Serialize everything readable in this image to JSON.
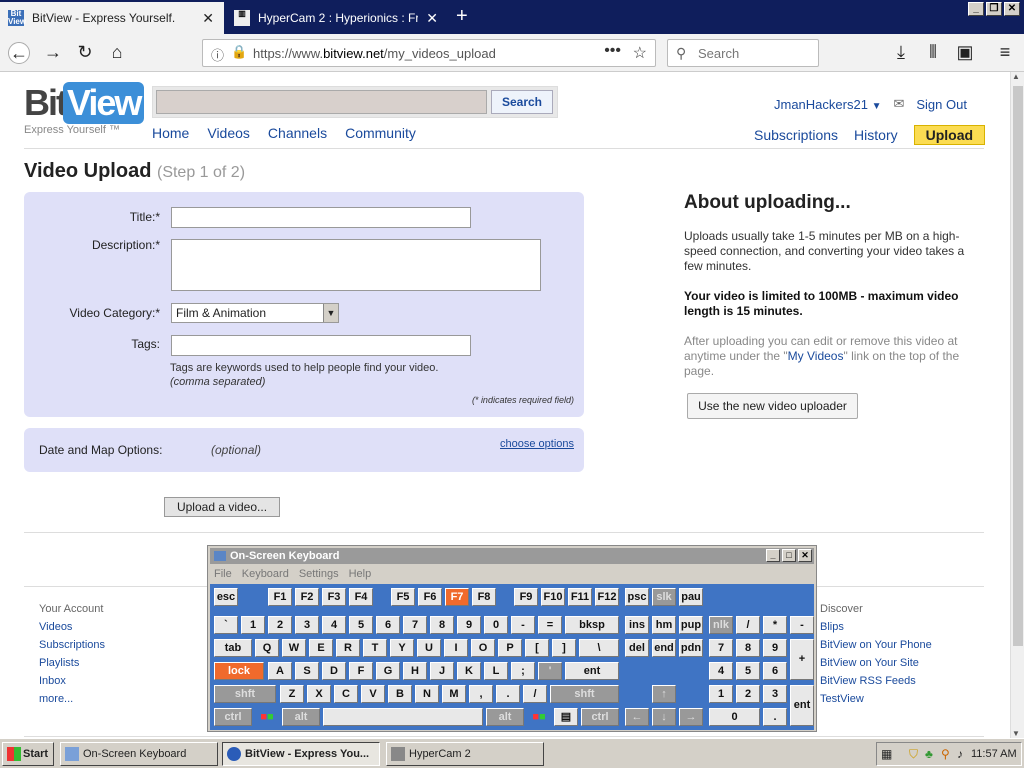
{
  "browser": {
    "tabs": [
      {
        "title": "BitView - Express Yourself.",
        "favicon": "bitview-icon"
      },
      {
        "title": "HyperCam 2 : Hyperionics : Free D",
        "favicon": "hyperionics-icon"
      }
    ],
    "url_prefix": "https://www.",
    "url_domain": "bitview.net",
    "url_path": "/my_videos_upload",
    "search_placeholder": "Search"
  },
  "site": {
    "logo_bit": "Bit",
    "logo_view": "View",
    "tagline": "Express Yourself ™",
    "search_button": "Search",
    "nav": [
      "Home",
      "Videos",
      "Channels",
      "Community"
    ],
    "username": "JmanHackers21",
    "signout": "Sign Out",
    "right_nav": [
      "Subscriptions",
      "History"
    ],
    "upload_button": "Upload"
  },
  "upload": {
    "title": "Video Upload",
    "step": "(Step 1 of 2)",
    "title_label": "Title:*",
    "desc_label": "Description:*",
    "category_label": "Video Category:*",
    "category_value": "Film & Animation",
    "tags_label": "Tags:",
    "tags_help": "Tags are keywords used to help people find your video.",
    "tags_help2": "(comma separated)",
    "required_note": "(* indicates required field)",
    "date_label": "Date and Map Options:",
    "date_optional": "(optional)",
    "choose_options": "choose options",
    "upload_button": "Upload a video..."
  },
  "about": {
    "heading": "About uploading...",
    "p1": "Uploads usually take 1-5 minutes per MB on a high-speed connection, and converting your video takes a few minutes.",
    "p2": "Your video is limited to 100MB - maximum video length is 15 minutes.",
    "p3a": "After uploading you can edit or remove this video at anytime under the \"",
    "p3link": "My Videos",
    "p3b": "\" link on the top of the page.",
    "new_uploader": "Use the new video uploader"
  },
  "footer": {
    "account_heading": "Your Account",
    "account_links": [
      "Videos",
      "Subscriptions",
      "Playlists",
      "Inbox",
      "more..."
    ],
    "discover_heading": "Discover",
    "discover_links": [
      "Blips",
      "BitView on Your Phone",
      "BitView on Your Site",
      "BitView RSS Feeds",
      "TestView"
    ]
  },
  "osk": {
    "title": "On-Screen Keyboard",
    "menu": [
      "File",
      "Keyboard",
      "Settings",
      "Help"
    ]
  },
  "taskbar": {
    "start": "Start",
    "items": [
      "On-Screen Keyboard",
      "BitView - Express You...",
      "HyperCam 2"
    ],
    "clock": "11:57 AM"
  }
}
